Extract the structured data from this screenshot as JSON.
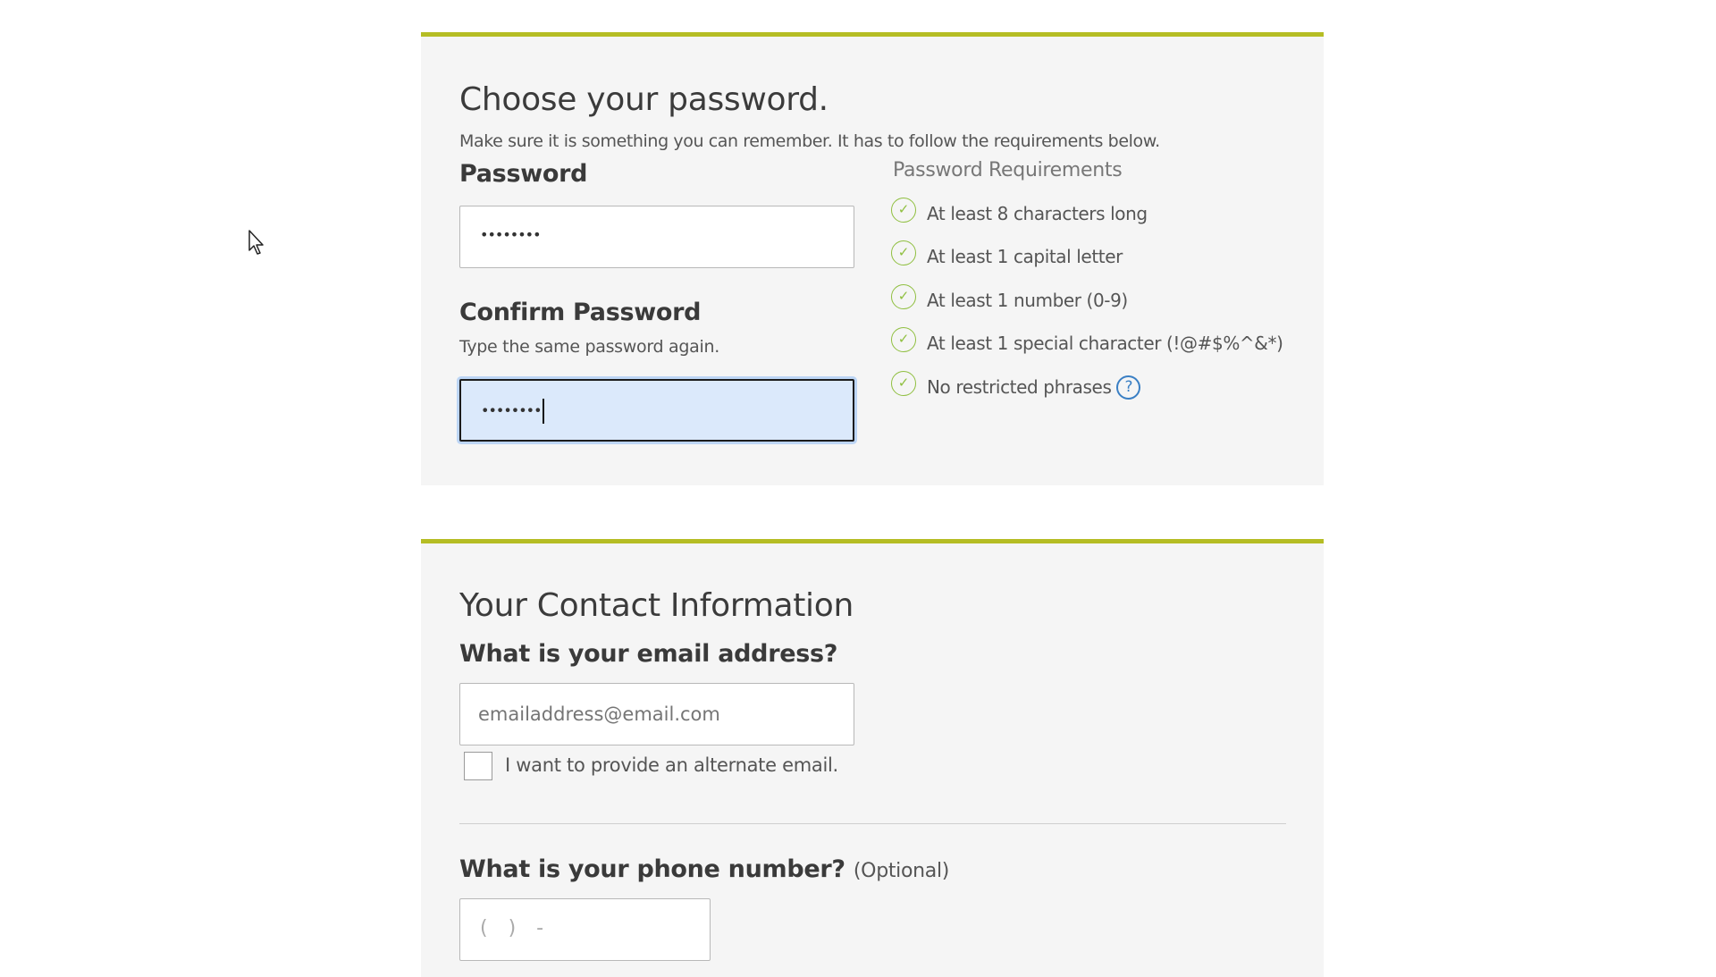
{
  "password_section": {
    "title": "Choose your password.",
    "subtitle": "Make sure it is something you can remember. It has to follow the requirements below.",
    "password_label": "Password",
    "password_value": "••••••••",
    "confirm_label": "Confirm Password",
    "confirm_hint": "Type the same password again.",
    "confirm_value": "••••••••",
    "requirements_title": "Password Requirements",
    "requirements": [
      {
        "label": "At least 8 characters long",
        "met": true,
        "icon": "check-circle-icon"
      },
      {
        "label": "At least 1 capital letter",
        "met": true,
        "icon": "check-circle-icon"
      },
      {
        "label": "At least 1 number (0-9)",
        "met": true,
        "icon": "check-circle-icon"
      },
      {
        "label": "At least 1 special character (!@#$%^&*)",
        "met": true,
        "icon": "check-circle-icon"
      },
      {
        "label": "No restricted phrases",
        "met": true,
        "icon": "check-circle-icon"
      }
    ],
    "help_glyph": "?"
  },
  "contact_section": {
    "title": "Your Contact Information",
    "email_label": "What is your email address?",
    "email_placeholder": "emailaddress@email.com",
    "alternate_email_label": "I want to provide an alternate email.",
    "phone_label": "What is your phone number?",
    "phone_optional": "(Optional)",
    "phone_placeholder": "(   )   -"
  },
  "colors": {
    "accent_bar": "#b5bd24",
    "check_green": "#8fbf3f",
    "help_blue": "#3a7fc4",
    "focus_bg": "#dbe9fb",
    "panel_bg": "#f5f5f5"
  }
}
